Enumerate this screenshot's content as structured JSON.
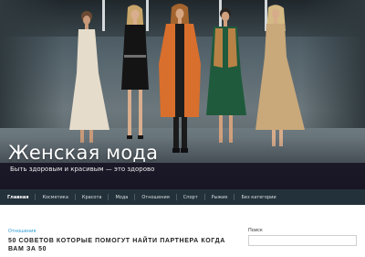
{
  "site": {
    "title": "Женская мода",
    "tagline": "Быть здоровым и красивым — это здорово"
  },
  "nav": {
    "items": [
      {
        "label": "Главная",
        "active": true
      },
      {
        "label": "Косметика",
        "active": false
      },
      {
        "label": "Красота",
        "active": false
      },
      {
        "label": "Мода",
        "active": false
      },
      {
        "label": "Отношения",
        "active": false
      },
      {
        "label": "Спорт",
        "active": false
      },
      {
        "label": "Рыжие",
        "active": false
      },
      {
        "label": "Без категории",
        "active": false
      }
    ]
  },
  "post": {
    "category": "Отношения",
    "title": "50 советов которые помогут найти партнера когда вам за 50"
  },
  "sidebar": {
    "search_label": "Поиск",
    "search_value": ""
  },
  "colors": {
    "nav_bg": "#23313a",
    "link": "#2a9bd4",
    "tagline_bg": "#161222"
  }
}
